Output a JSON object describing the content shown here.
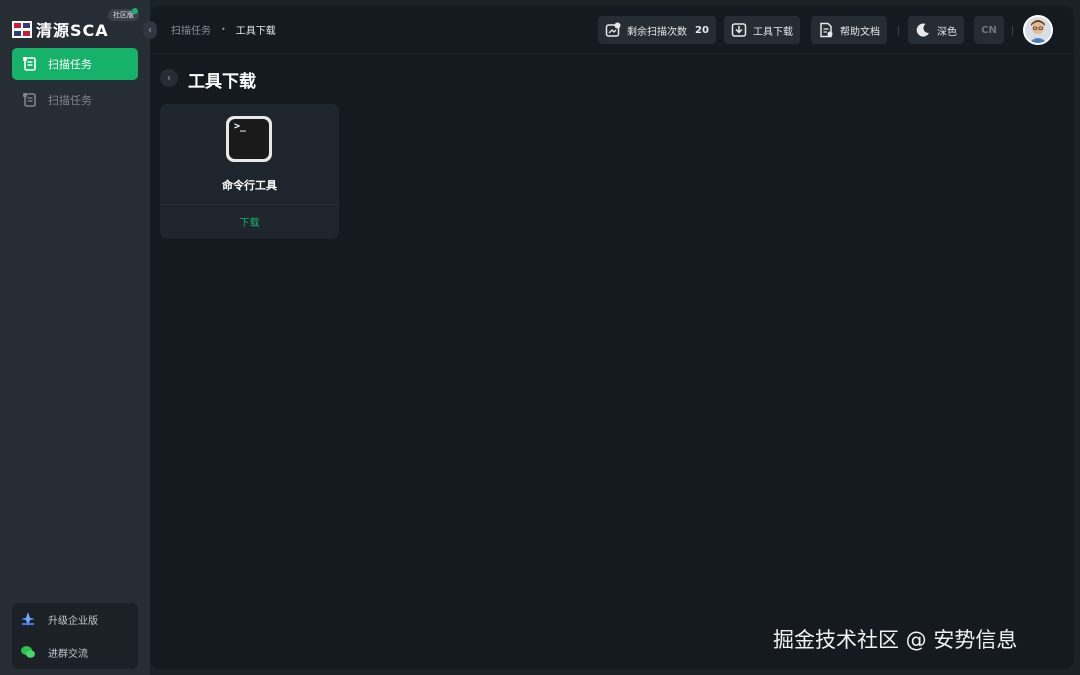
{
  "brand": {
    "name": "清源SCA",
    "edition": "社区版"
  },
  "sidebar": {
    "items": [
      {
        "label": "扫描任务",
        "icon": "scroll-icon",
        "active": true
      },
      {
        "label": "扫描任务",
        "icon": "scroll-icon",
        "active": false
      }
    ],
    "bottom": [
      {
        "label": "升级企业版",
        "icon": "upgrade-icon"
      },
      {
        "label": "进群交流",
        "icon": "wechat-icon"
      }
    ]
  },
  "header": {
    "breadcrumb": {
      "parent": "扫描任务",
      "separator": "•",
      "current": "工具下载"
    },
    "scans_label": "剩余扫描次数",
    "scans_count": "20",
    "tool_download": "工具下载",
    "help_docs": "帮助文档",
    "theme": "深色",
    "lang": "CN"
  },
  "page": {
    "title": "工具下载",
    "tools": [
      {
        "icon_text": ">_",
        "name": "命令行工具",
        "action": "下载"
      }
    ]
  },
  "watermark": "掘金技术社区 @ 安势信息",
  "colors": {
    "accent": "#17b26a",
    "sidebar_bg": "#272d35",
    "main_bg": "#141a20",
    "card_bg": "#1f252c"
  }
}
